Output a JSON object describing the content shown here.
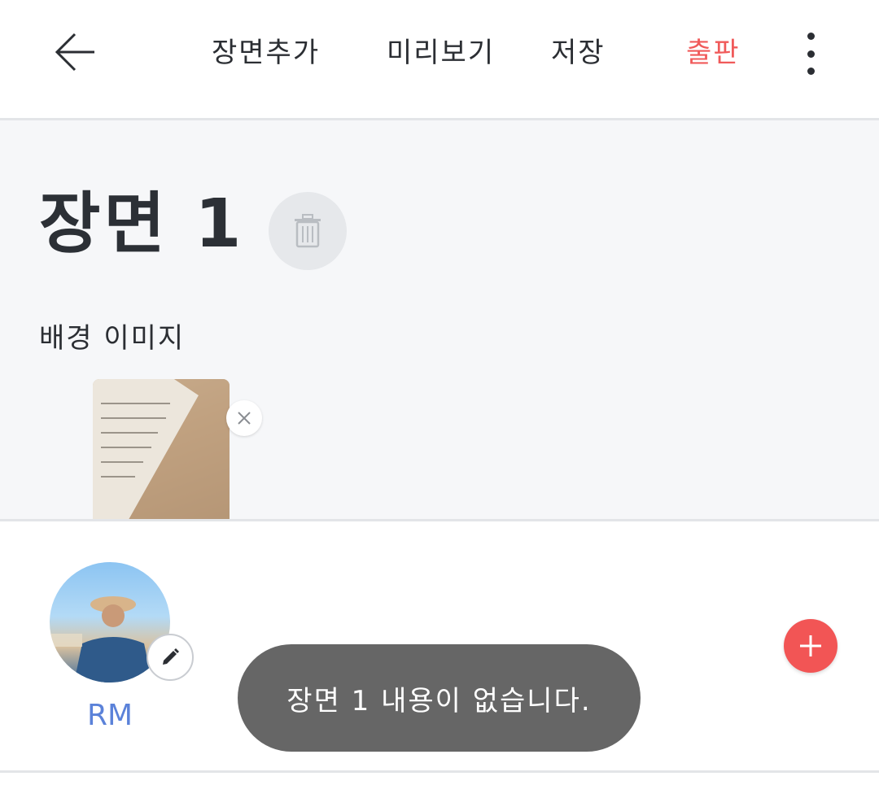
{
  "header": {
    "back_icon": "arrow-left-icon",
    "menu": {
      "add_scene": "장면추가",
      "preview": "미리보기",
      "save": "저장",
      "publish": "출판"
    },
    "more_icon": "more-vertical-icon",
    "accent_color": "#f05a5a"
  },
  "scene": {
    "title": "장면 1",
    "delete_icon": "trash-icon",
    "background_label": "배경 이미지",
    "remove_icon": "close-icon"
  },
  "character": {
    "name": "RM",
    "edit_icon": "pencil-icon",
    "name_color": "#5b82d9"
  },
  "add_button": {
    "icon": "plus-icon",
    "color": "#f25555"
  },
  "toast": {
    "message": "장면 1 내용이 없습니다."
  }
}
